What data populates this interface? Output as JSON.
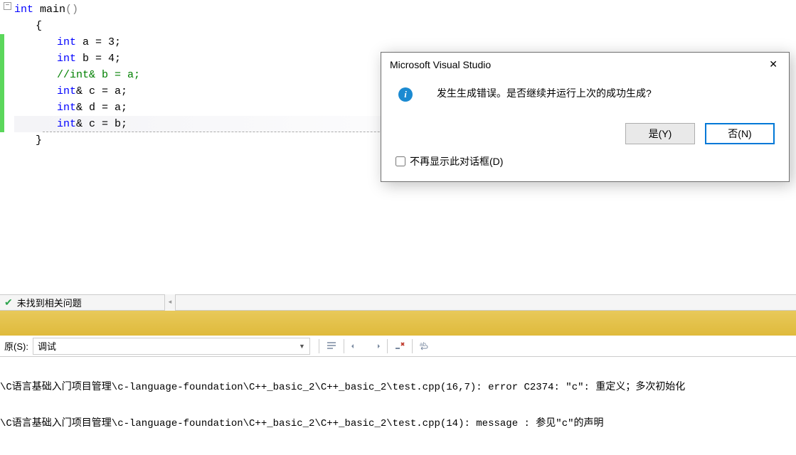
{
  "code": {
    "line1": {
      "kw": "int",
      "name": "main",
      "parens": "()"
    },
    "line2": "{",
    "line3": {
      "kw": "int",
      "rest": " a = 3;"
    },
    "line4": {
      "kw": "int",
      "rest": " b = 4;"
    },
    "line5": "//int& b = a;",
    "line6": {
      "kw": "int",
      "rest": "& c = a;"
    },
    "line7": {
      "kw": "int",
      "rest": "& d = a;"
    },
    "line8": {
      "kw": "int",
      "rest": "& c = b;"
    },
    "line9": "}"
  },
  "dialog": {
    "title": "Microsoft Visual Studio",
    "message": "发生生成错误。是否继续并运行上次的成功生成?",
    "yes": "是(Y)",
    "no": "否(N)",
    "dont_show": "不再显示此对话框(D)"
  },
  "issues": {
    "text": "未找到相关问题"
  },
  "output": {
    "source_label": "原(S):",
    "selected": "调试",
    "lines": [
      "\\C语言基础入门项目管理\\c-language-foundation\\C++_basic_2\\C++_basic_2\\test.cpp(16,7): error C2374: \"c\": 重定义；多次初始化",
      "\\C语言基础入门项目管理\\c-language-foundation\\C++_basic_2\\C++_basic_2\\test.cpp(14): message : 参见\"c\"的声明"
    ]
  }
}
